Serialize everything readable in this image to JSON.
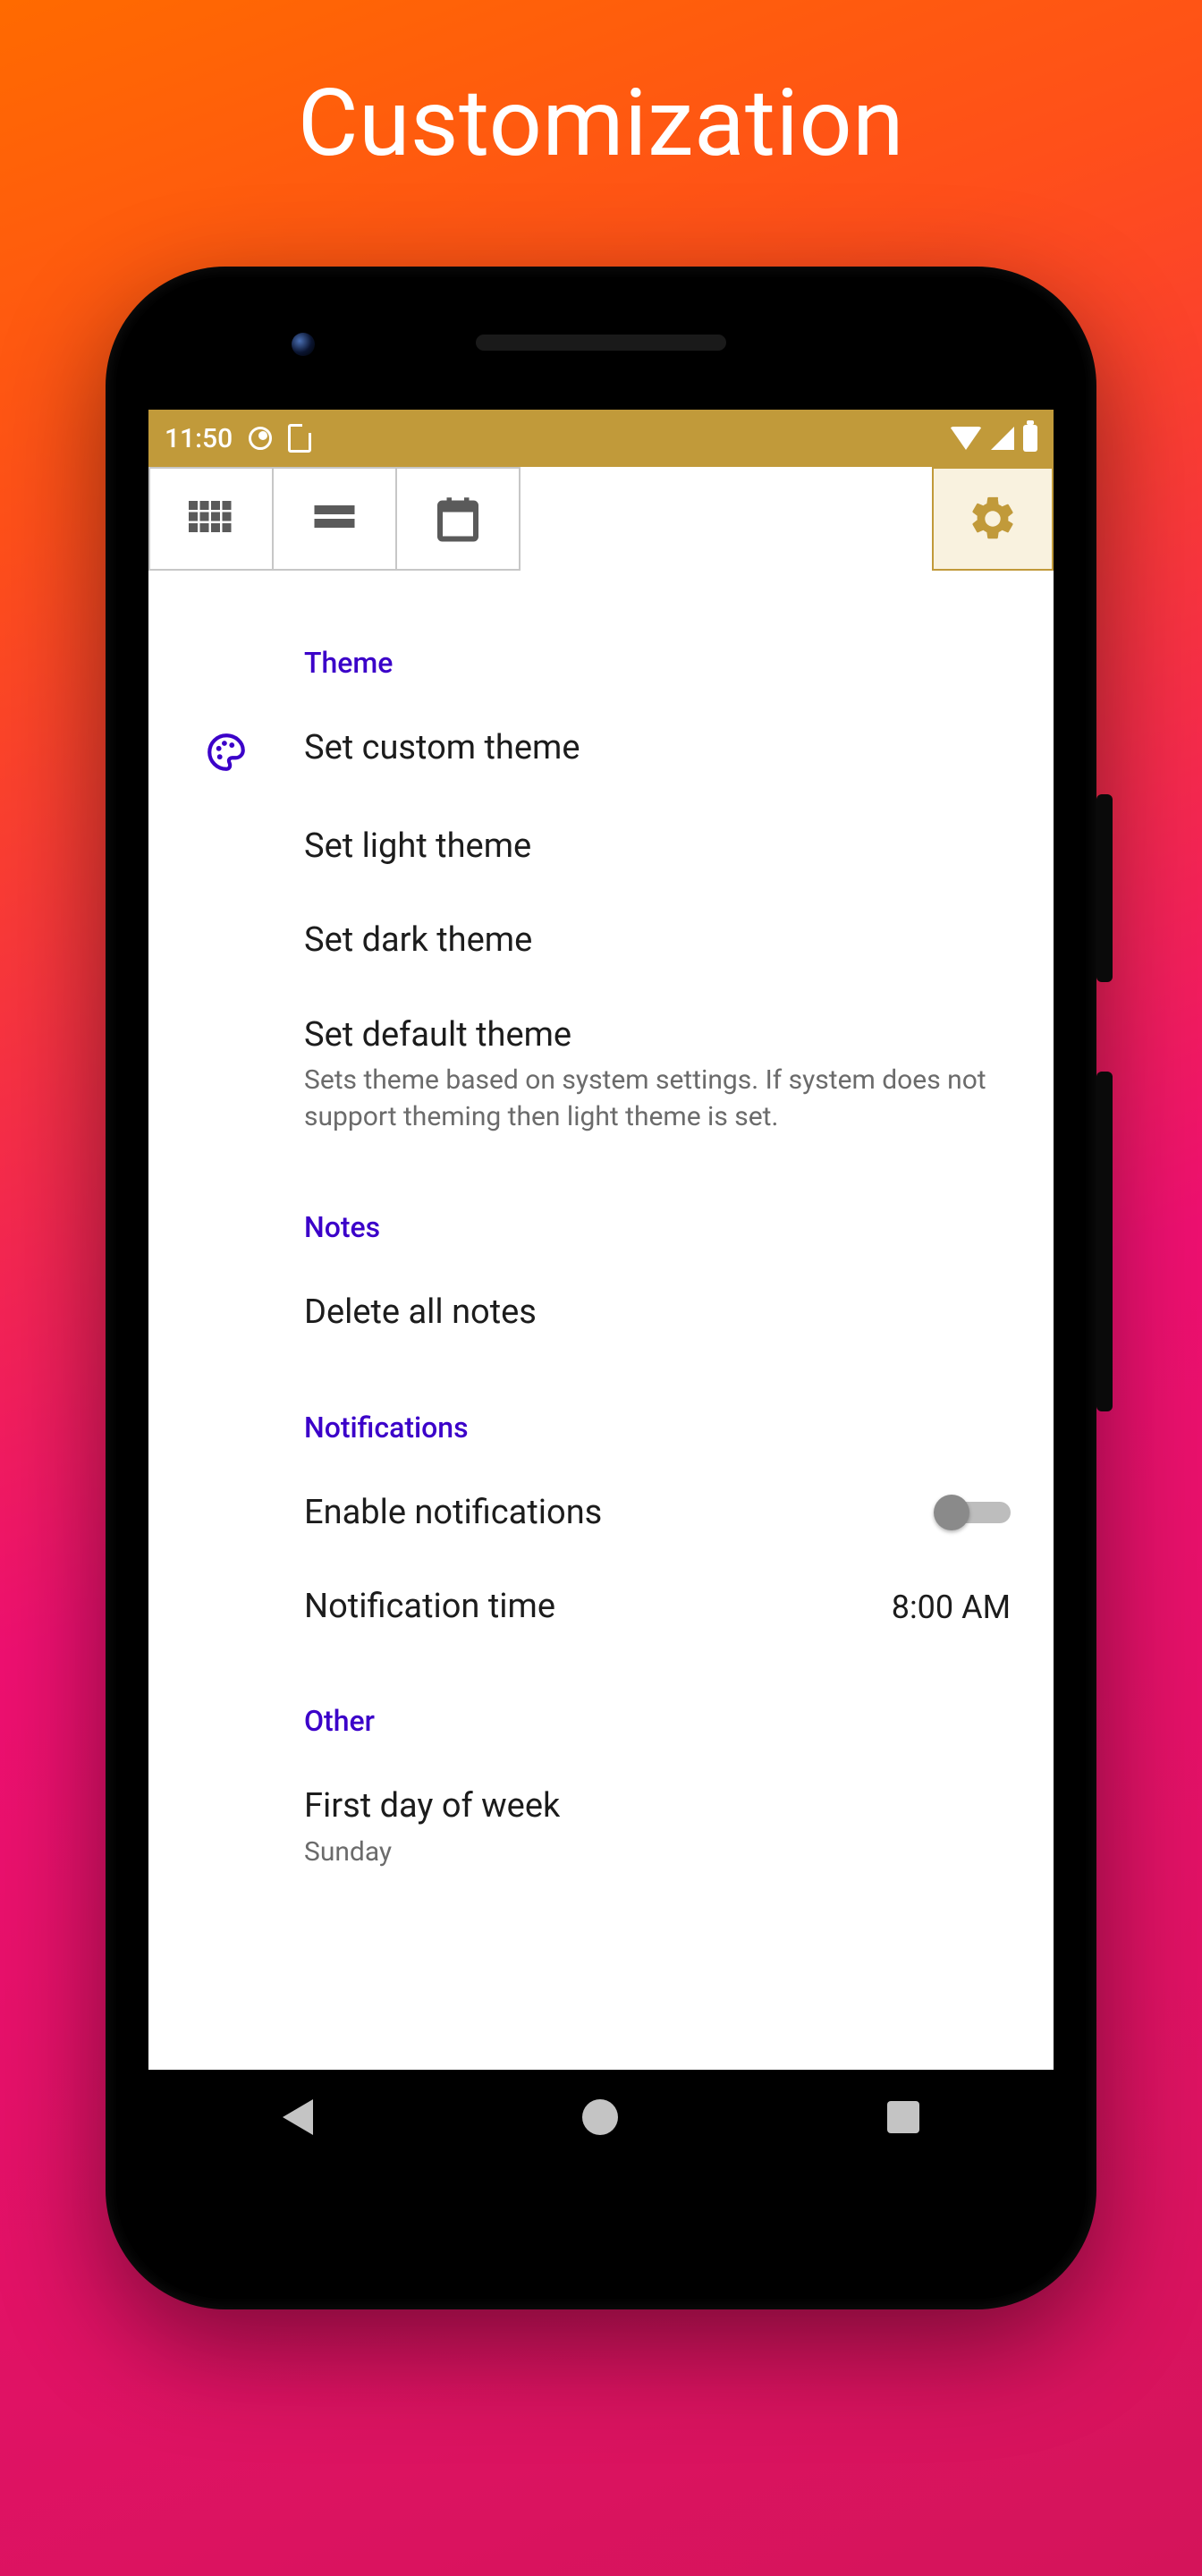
{
  "marketing": {
    "title": "Customization"
  },
  "status": {
    "time": "11:50"
  },
  "toolbar": {
    "grid": "grid-view",
    "list": "list-view",
    "calendar": "calendar-view",
    "settings": "settings"
  },
  "sections": {
    "theme": {
      "header": "Theme",
      "custom": "Set custom theme",
      "light": "Set light theme",
      "dark": "Set dark theme",
      "default_title": "Set default theme",
      "default_sub": "Sets theme based on system settings. If system does not support theming then light theme is set."
    },
    "notes": {
      "header": "Notes",
      "delete_all": "Delete all notes"
    },
    "notifications": {
      "header": "Notifications",
      "enable": "Enable notifications",
      "time_label": "Notification time",
      "time_value": "8:00 AM",
      "enabled_state": false
    },
    "other": {
      "header": "Other",
      "first_day_label": "First day of week",
      "first_day_value": "Sunday"
    }
  }
}
